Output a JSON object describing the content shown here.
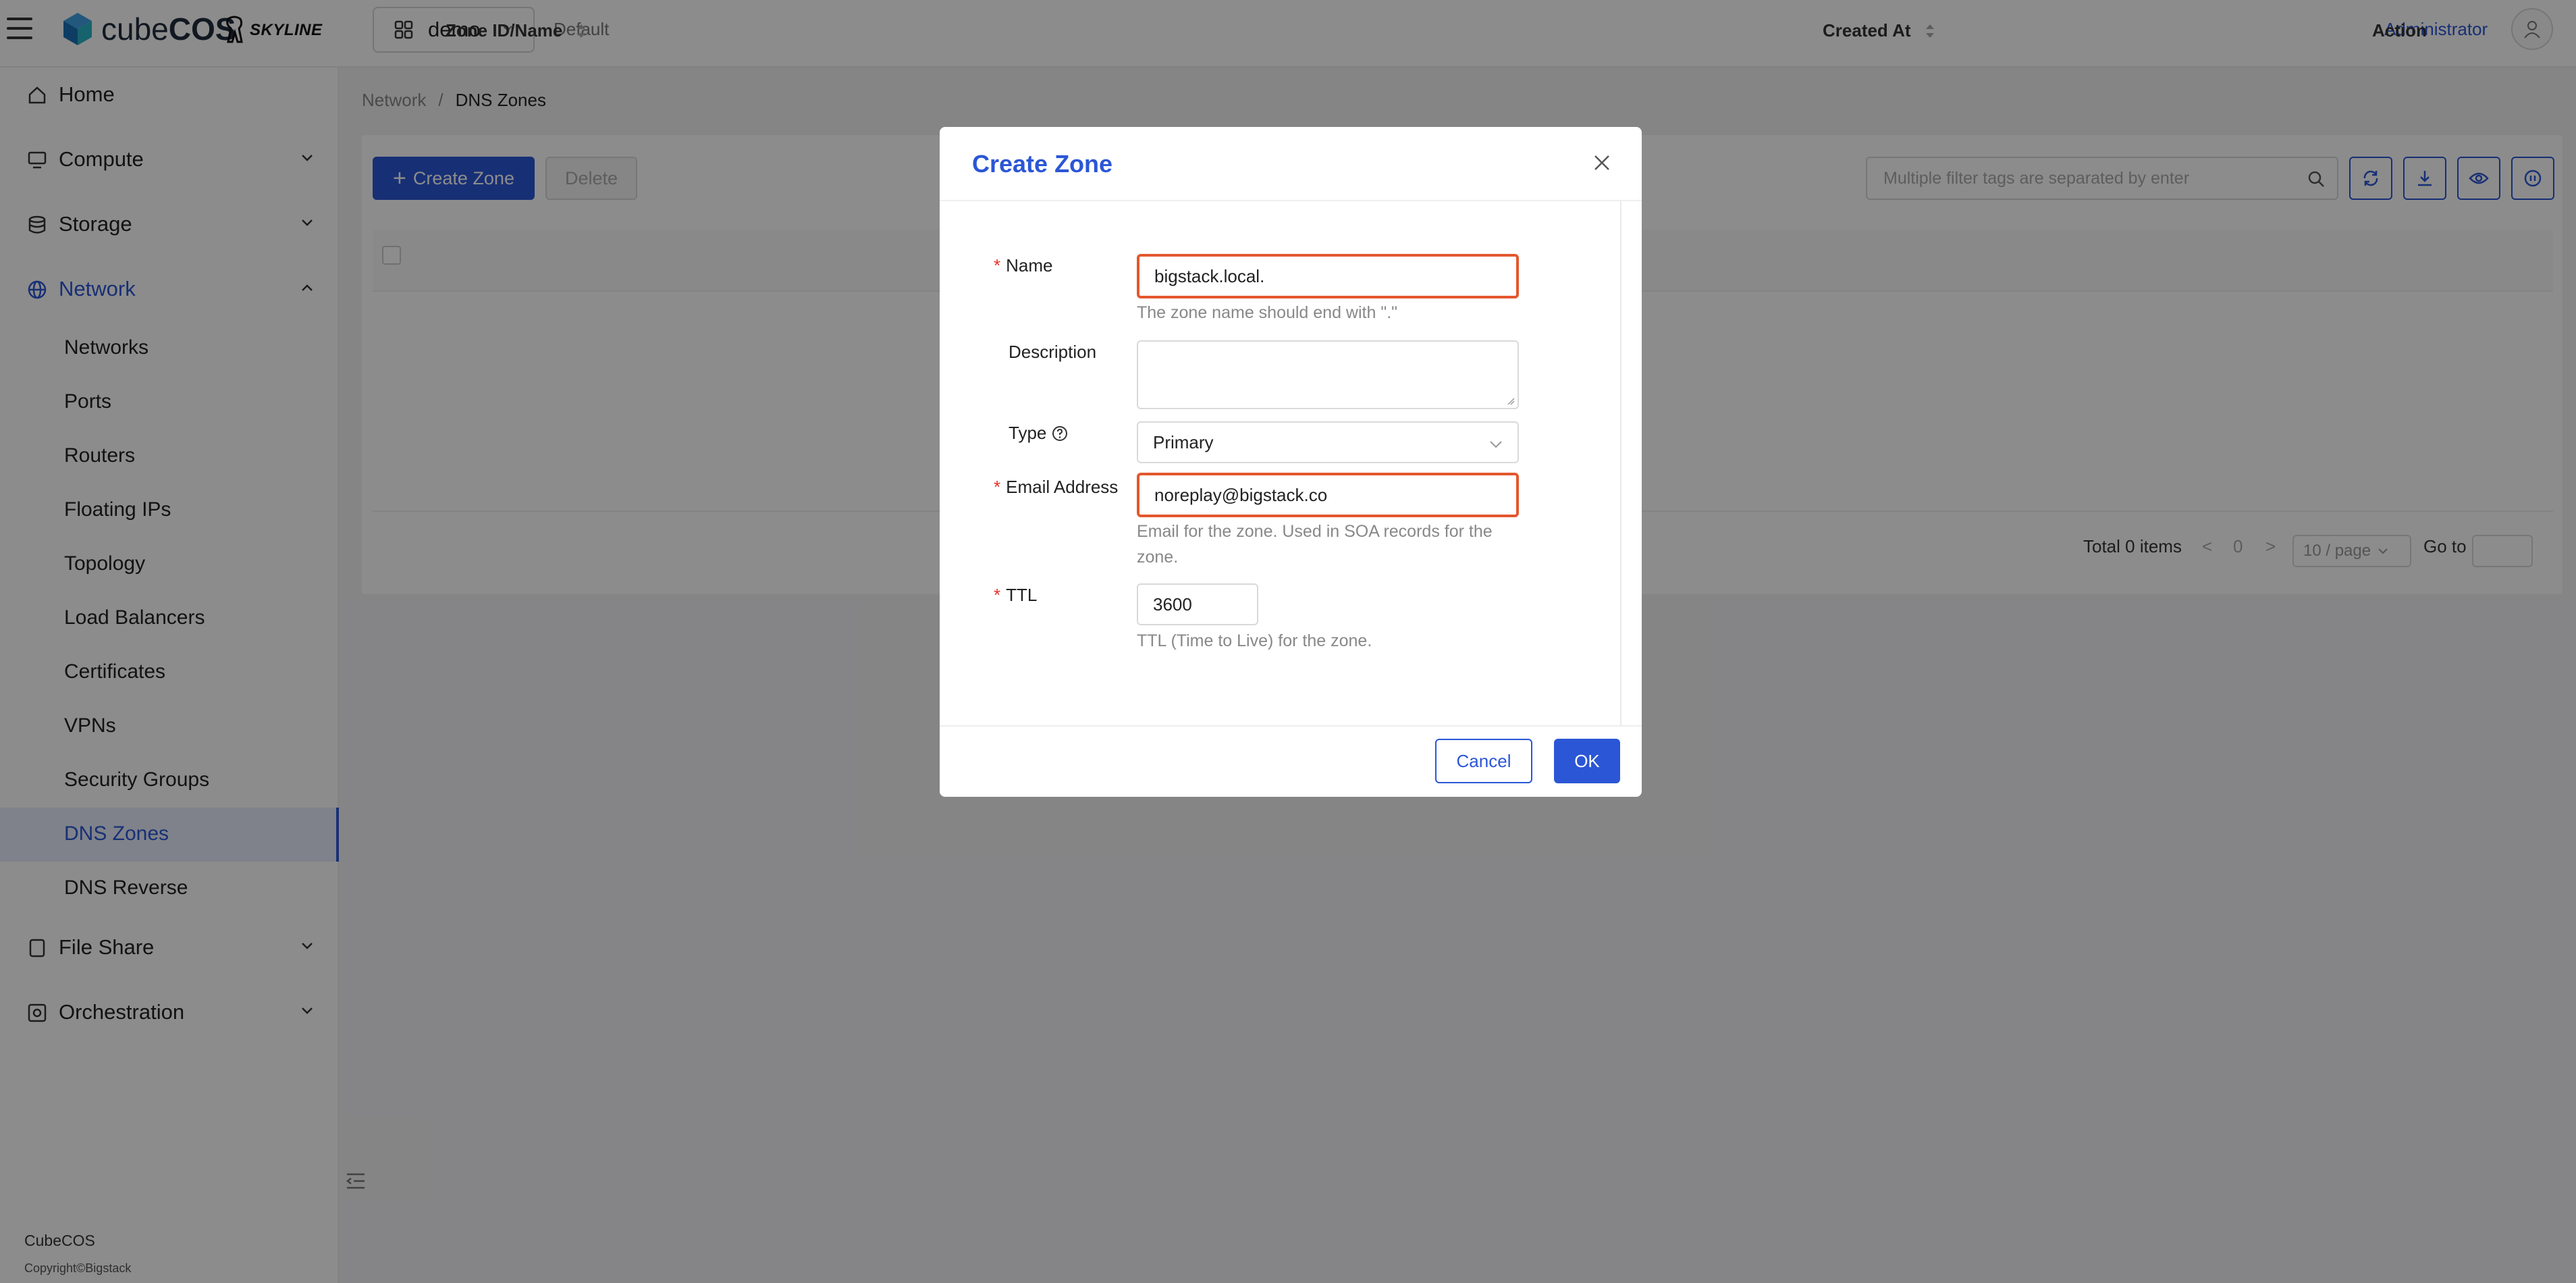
{
  "app": {
    "logo_text_light": "cube",
    "logo_text_bold": "COS",
    "partner_logo": "SKYLINE",
    "project": "demo",
    "domain": "Default",
    "user": "Administrator"
  },
  "sidebar": {
    "home": "Home",
    "compute": "Compute",
    "storage": "Storage",
    "network": "Network",
    "network_items": [
      "Networks",
      "Ports",
      "Routers",
      "Floating IPs",
      "Topology",
      "Load Balancers",
      "Certificates",
      "VPNs",
      "Security Groups",
      "DNS Zones",
      "DNS Reverse"
    ],
    "selected": "DNS Zones",
    "file_share": "File Share",
    "orchestration": "Orchestration",
    "footer_brand": "CubeCOS",
    "footer_copyright": "Copyright©Bigstack"
  },
  "breadcrumb": {
    "parent": "Network",
    "separator": "/",
    "current": "DNS Zones"
  },
  "toolbar": {
    "create_label": "Create Zone",
    "delete_label": "Delete",
    "filter_placeholder": "Multiple filter tags are separated by enter"
  },
  "table": {
    "columns": [
      "Zone ID/Name",
      "Created At",
      "Action"
    ]
  },
  "pagination": {
    "total": "Total 0 items",
    "current_page": "0",
    "page_size": "10 / page",
    "goto_label": "Go to"
  },
  "modal": {
    "title": "Create Zone",
    "name_label": "Name",
    "name_value": "bigstack.local.",
    "name_help": "The zone name should end with \".\"",
    "description_label": "Description",
    "type_label": "Type",
    "type_value": "Primary",
    "email_label": "Email Address",
    "email_value": "noreplay@bigstack.co",
    "email_help": "Email for the zone. Used in SOA records for the zone.",
    "ttl_label": "TTL",
    "ttl_value": "3600",
    "ttl_help": "TTL (Time to Live) for the zone.",
    "cancel_label": "Cancel",
    "ok_label": "OK",
    "required_mark": "*"
  },
  "colors": {
    "accent": "#2b56d6",
    "error": "#e4572e",
    "required": "#e5312b"
  }
}
